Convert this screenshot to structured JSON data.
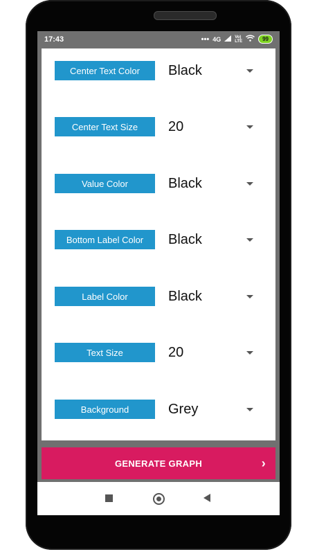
{
  "status": {
    "time": "17:43",
    "dots": "•••",
    "network": "4G",
    "lte_top": "Vo)",
    "lte_bottom": "LTE",
    "battery": "99"
  },
  "settings": [
    {
      "label": "Center Text Color",
      "value": "Black"
    },
    {
      "label": "Center Text Size",
      "value": "20"
    },
    {
      "label": "Value Color",
      "value": "Black"
    },
    {
      "label": "Bottom Label Color",
      "value": "Black"
    },
    {
      "label": "Label Color",
      "value": "Black"
    },
    {
      "label": "Text Size",
      "value": "20"
    },
    {
      "label": "Background",
      "value": "Grey"
    }
  ],
  "generate": {
    "label": "GENERATE GRAPH",
    "chevron": "›"
  },
  "colors": {
    "label_bg": "#2196cc",
    "button_bg": "#d81b60",
    "frame_bg": "#707070",
    "battery": "#7ed321"
  },
  "icons": {
    "recents": "square-icon",
    "home": "circle-icon",
    "back": "triangle-back-icon",
    "wifi": "wifi-icon",
    "signal": "signal-icon"
  }
}
